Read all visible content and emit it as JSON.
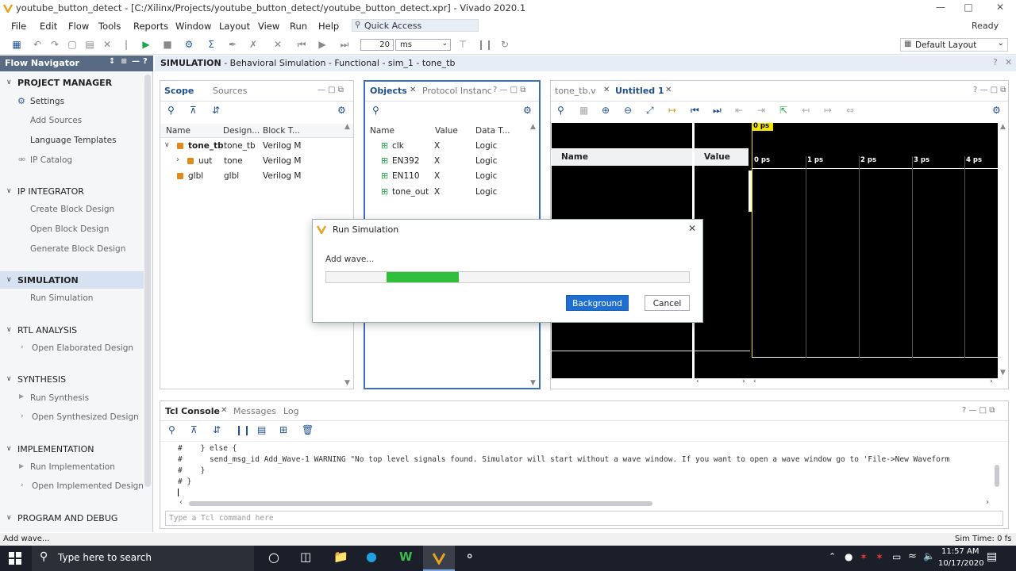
{
  "window": {
    "title": "youtube_button_detect - [C:/Xilinx/Projects/youtube_button_detect/youtube_button_detect.xpr] - Vivado 2020.1",
    "status": "Ready"
  },
  "menu": [
    "File",
    "Edit",
    "Flow",
    "Tools",
    "Reports",
    "Window",
    "Layout",
    "View",
    "Run",
    "Help"
  ],
  "quick_access": "Quick Access",
  "toolbar": {
    "run_time": "20",
    "run_unit": "ms",
    "layout": "Default Layout"
  },
  "flow_nav": {
    "title": "Flow Navigator",
    "sections": [
      {
        "label": "PROJECT MANAGER",
        "items": [
          "Settings",
          "Add Sources",
          "Language Templates",
          "IP Catalog"
        ]
      },
      {
        "label": "IP INTEGRATOR",
        "items": [
          "Create Block Design",
          "Open Block Design",
          "Generate Block Design"
        ]
      },
      {
        "label": "SIMULATION",
        "items": [
          "Run Simulation"
        ]
      },
      {
        "label": "RTL ANALYSIS",
        "items": [
          "Open Elaborated Design"
        ]
      },
      {
        "label": "SYNTHESIS",
        "items": [
          "Run Synthesis",
          "Open Synthesized Design"
        ]
      },
      {
        "label": "IMPLEMENTATION",
        "items": [
          "Run Implementation",
          "Open Implemented Design"
        ]
      },
      {
        "label": "PROGRAM AND DEBUG",
        "items": []
      }
    ]
  },
  "sim_header": {
    "bold": "SIMULATION",
    "rest": " - Behavioral Simulation - Functional - sim_1 - tone_tb"
  },
  "scope": {
    "tabs": [
      "Scope",
      "Sources"
    ],
    "columns": [
      "Name",
      "Design...",
      "Block T..."
    ],
    "rows": [
      {
        "name": "tone_tb",
        "design": "tone_tb",
        "block": "Verilog M"
      },
      {
        "name": "uut",
        "design": "tone",
        "block": "Verilog M"
      },
      {
        "name": "glbl",
        "design": "glbl",
        "block": "Verilog M"
      }
    ]
  },
  "objects": {
    "tabs": [
      "Objects",
      "Protocol Instanc"
    ],
    "columns": [
      "Name",
      "Value",
      "Data T..."
    ],
    "rows": [
      {
        "name": "clk",
        "value": "X",
        "type": "Logic"
      },
      {
        "name": "EN392",
        "value": "X",
        "type": "Logic"
      },
      {
        "name": "EN110",
        "value": "X",
        "type": "Logic"
      },
      {
        "name": "tone_out",
        "value": "X",
        "type": "Logic"
      }
    ]
  },
  "wave": {
    "tabs": [
      "tone_tb.v",
      "Untitled 1"
    ],
    "name_col": "Name",
    "value_col": "Value",
    "cursor": "0 ps",
    "ticks": [
      "0 ps",
      "1 ps",
      "2 ps",
      "3 ps",
      "4 ps"
    ]
  },
  "dialog": {
    "title": "Run Simulation",
    "message": "Add wave...",
    "progress": 0.2,
    "background": "Background",
    "cancel": "Cancel"
  },
  "console": {
    "tabs": [
      "Tcl Console",
      "Messages",
      "Log"
    ],
    "lines": [
      "#    } else {",
      "#      send_msg_id Add_Wave-1 WARNING \"No top level signals found. Simulator will start without a wave window. If you want to open a wave window go to 'File->New Waveform",
      "#    }",
      "# }"
    ],
    "placeholder": "Type a Tcl command here"
  },
  "status": {
    "left": "Add wave...",
    "right": "Sim Time: 0 fs"
  },
  "taskbar": {
    "search": "Type here to search",
    "time": "11:57 AM",
    "date": "10/17/2020"
  },
  "colors": {
    "accent": "#1f6fd1",
    "progress": "#2fbf3a",
    "nav_header": "#596a85",
    "wave_cursor": "#f2e300"
  }
}
